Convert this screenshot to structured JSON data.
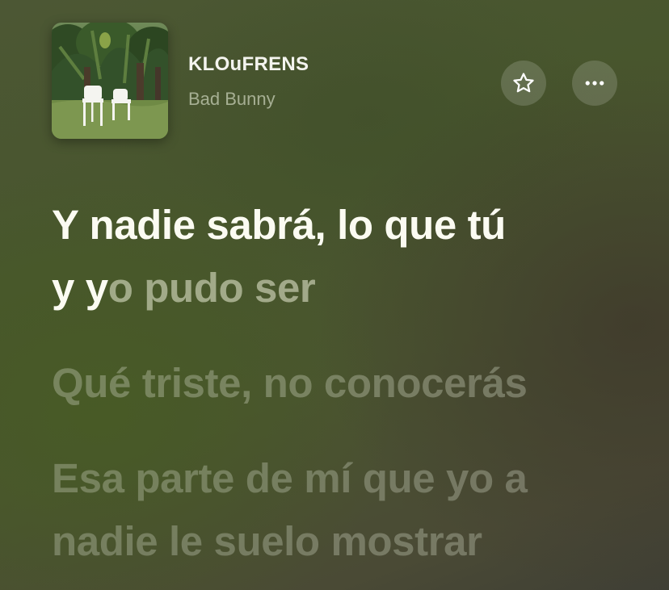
{
  "track": {
    "title": "KLOuFRENS",
    "artist": "Bad Bunny"
  },
  "actions": {
    "favorite_icon": "star-outline-icon",
    "more_icon": "ellipsis-icon"
  },
  "lyrics": {
    "current_sung_1": "Y nadie sabrá, lo que tú",
    "current_sung_2": "y y",
    "current_rest_2": "o pudo ser",
    "next_line": "Qué triste, no conocerás",
    "following_line_1": "Esa parte de mí que yo a",
    "following_line_2": "nadie le suelo mostrar"
  }
}
